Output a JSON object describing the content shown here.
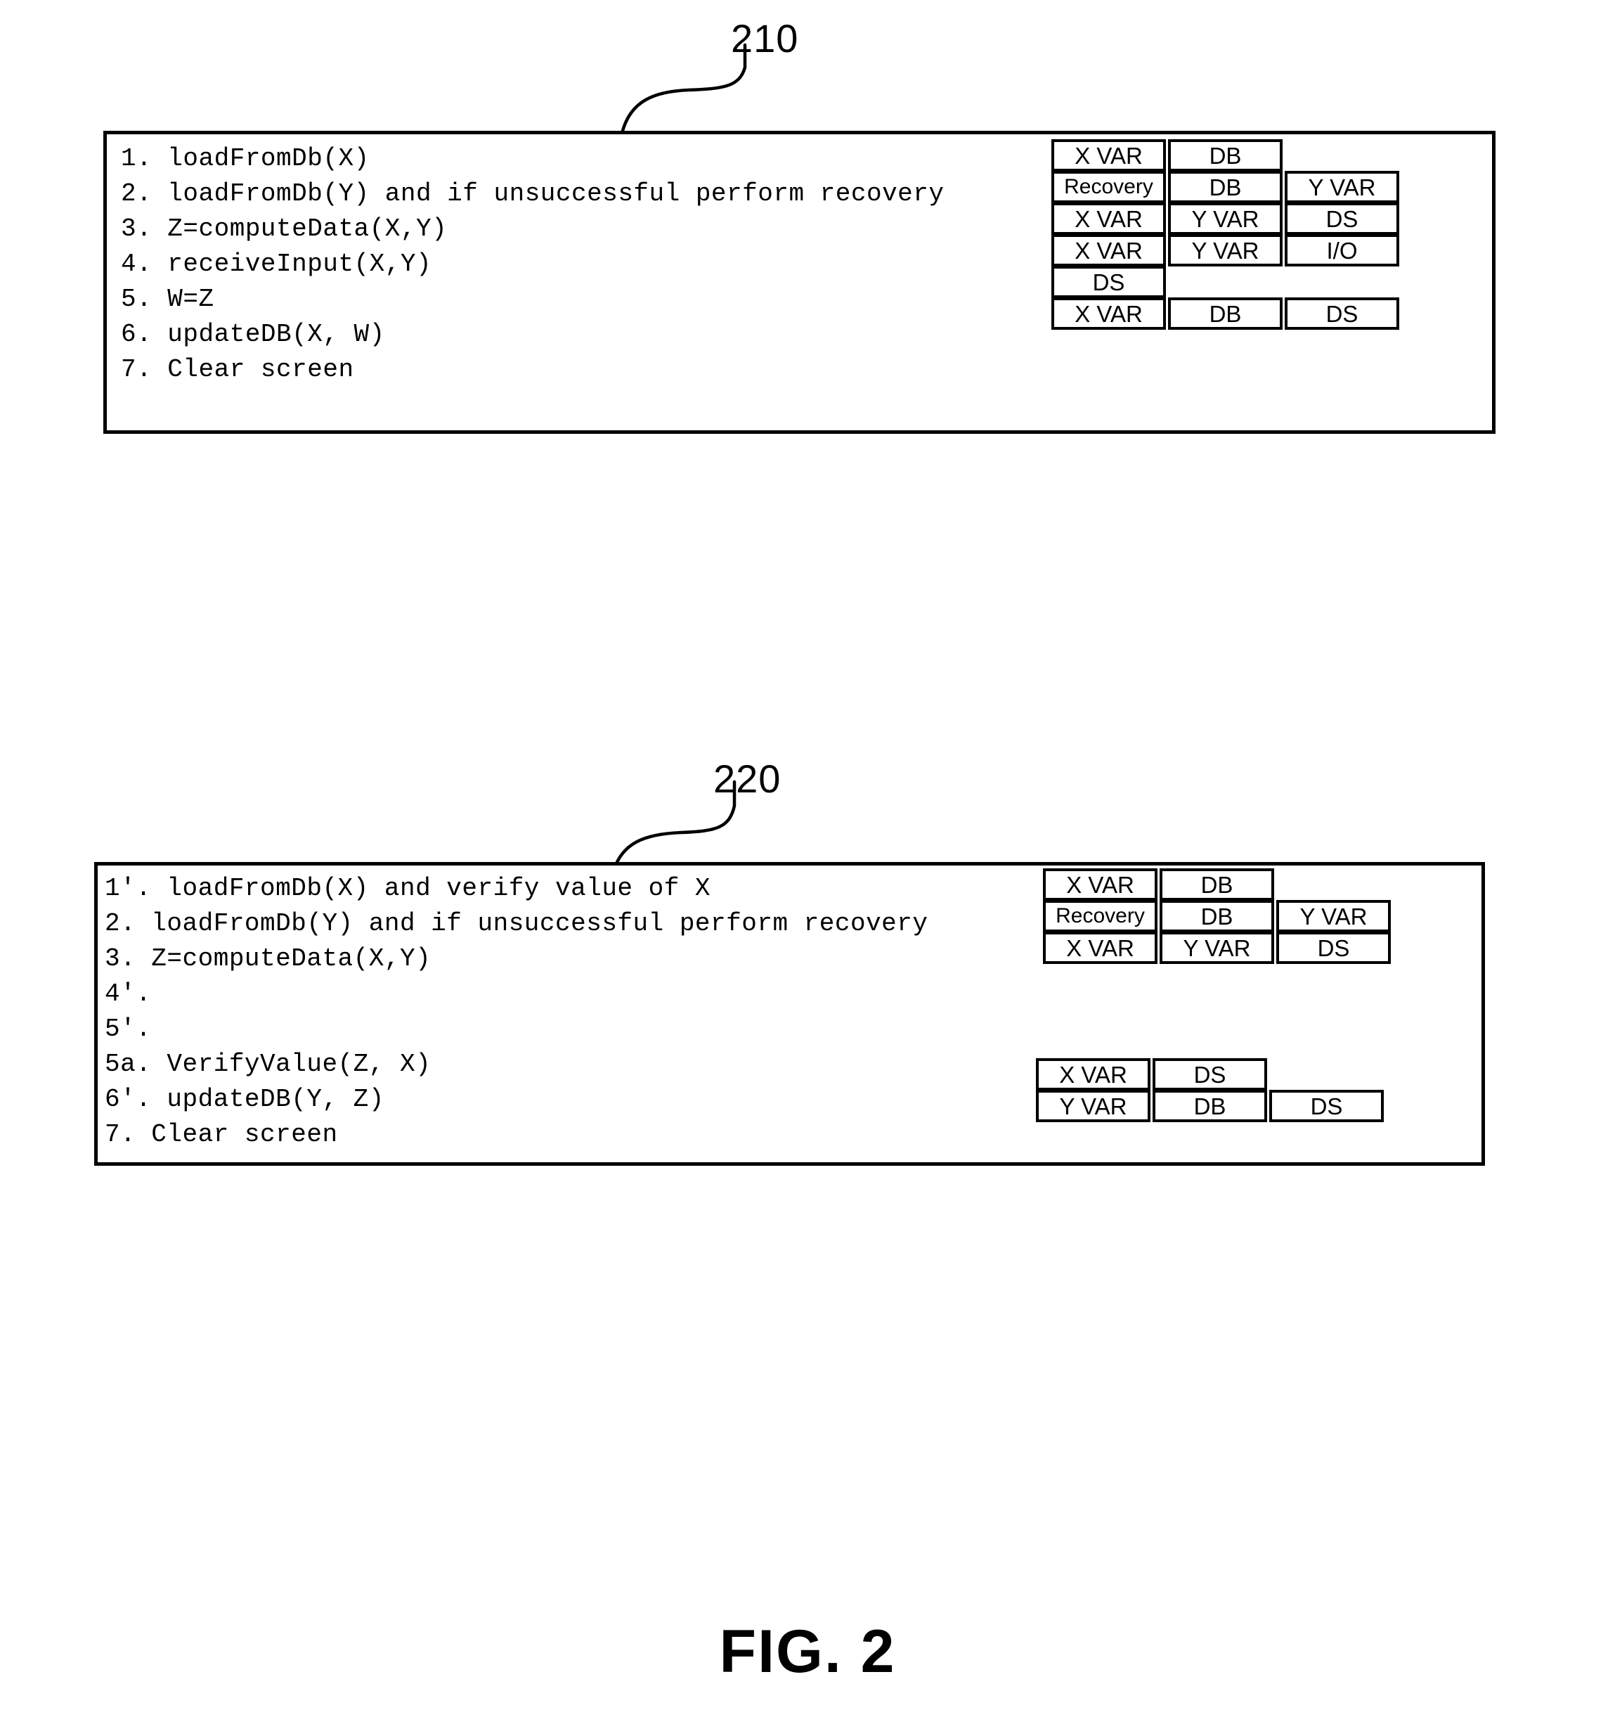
{
  "figure": {
    "caption": "FIG. 2",
    "blocks": [
      {
        "ref": "210",
        "code_lines": [
          "1. loadFromDb(X)",
          "2. loadFromDb(Y) and if unsuccessful perform recovery",
          "3. Z=computeData(X,Y)",
          "4. receiveInput(X,Y)",
          "5. W=Z",
          "6. updateDB(X, W)",
          "7. Clear screen"
        ],
        "tag_rows": [
          {
            "line": 1,
            "cells": [
              "X VAR",
              "DB"
            ]
          },
          {
            "line": 2,
            "cells": [
              "Recovery",
              "DB",
              "Y VAR"
            ]
          },
          {
            "line": 3,
            "cells": [
              "X VAR",
              "Y VAR",
              "DS"
            ]
          },
          {
            "line": 4,
            "cells": [
              "X VAR",
              "Y VAR",
              "I/O"
            ]
          },
          {
            "line": 5,
            "cells": [
              "DS"
            ]
          },
          {
            "line": 6,
            "cells": [
              "X VAR",
              "DB",
              "DS"
            ]
          },
          {
            "line": 7,
            "cells": []
          }
        ]
      },
      {
        "ref": "220",
        "code_lines": [
          "1'. loadFromDb(X) and verify value of X",
          "2. loadFromDb(Y) and if unsuccessful perform recovery",
          "3. Z=computeData(X,Y)",
          "4'.",
          "5'.",
          "5a. VerifyValue(Z, X)",
          "6'. updateDB(Y, Z)",
          "7. Clear screen"
        ],
        "tag_rows": [
          {
            "line": 1,
            "cells": [
              "X VAR",
              "DB"
            ]
          },
          {
            "line": 2,
            "cells": [
              "Recovery",
              "DB",
              "Y VAR"
            ]
          },
          {
            "line": 3,
            "cells": [
              "X VAR",
              "Y VAR",
              "DS"
            ]
          },
          {
            "line": 4,
            "cells": []
          },
          {
            "line": 5,
            "cells": []
          },
          {
            "line": 6,
            "cells": [
              "X VAR",
              "DS"
            ]
          },
          {
            "line": 7,
            "cells": [
              "Y VAR",
              "DB",
              "DS"
            ]
          },
          {
            "line": 8,
            "cells": []
          }
        ]
      }
    ]
  },
  "colors": {
    "ink": "#000000",
    "paper": "#ffffff"
  }
}
